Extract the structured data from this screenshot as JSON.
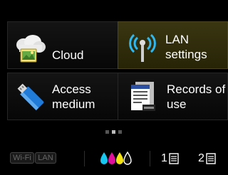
{
  "tiles": [
    {
      "id": "cloud",
      "label_lines": [
        "Cloud"
      ],
      "icon": "cloud-icon"
    },
    {
      "id": "lan",
      "label_lines": [
        "LAN",
        "settings"
      ],
      "icon": "wireless-antenna-icon"
    },
    {
      "id": "access",
      "label_lines": [
        "Access",
        "medium"
      ],
      "icon": "usb-drive-icon"
    },
    {
      "id": "records",
      "label_lines": [
        "Records of",
        "use"
      ],
      "icon": "document-log-icon"
    }
  ],
  "pager": {
    "pages": 3,
    "current": 2
  },
  "status": {
    "wifi_label": "Wi-Fi",
    "lan_label": "LAN",
    "ink_colors": [
      "#17c7f0",
      "#e0109c",
      "#f4e214",
      "#ffffff"
    ],
    "tray1_label": "1",
    "tray2_label": "2"
  },
  "colors": {
    "selected_tile": "#3a3612",
    "background": "#000000"
  }
}
